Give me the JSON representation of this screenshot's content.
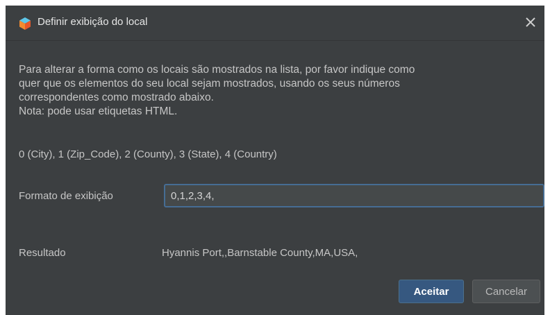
{
  "window": {
    "title": "Definir exibição do local",
    "icon": "app-cube-icon",
    "close_icon": "close-icon"
  },
  "intro": {
    "lines": [
      "Para alterar a forma como os locais são mostrados na lista, por favor indique como",
      "quer que os elementos do seu local sejam mostrados, usando os seus números",
      "correspondentes como mostrado abaixo.",
      "Nota: pode usar etiquetas HTML."
    ]
  },
  "field_codes": "0 (City), 1 (Zip_Code), 2 (County), 3 (State), 4 (Country)",
  "format": {
    "label": "Formato de exibição",
    "value": "0,1,2,3,4,"
  },
  "result": {
    "label": "Resultado",
    "value": "Hyannis Port,,Barnstable County,MA,USA,"
  },
  "buttons": {
    "accept_label": "Aceitar",
    "cancel_label": "Cancelar"
  },
  "colors": {
    "dialog_bg": "#3c3f41",
    "text": "#c6c6c6",
    "input_border_focus": "#466d94",
    "accept_bg": "#365880",
    "cancel_bg": "#4c5052"
  }
}
